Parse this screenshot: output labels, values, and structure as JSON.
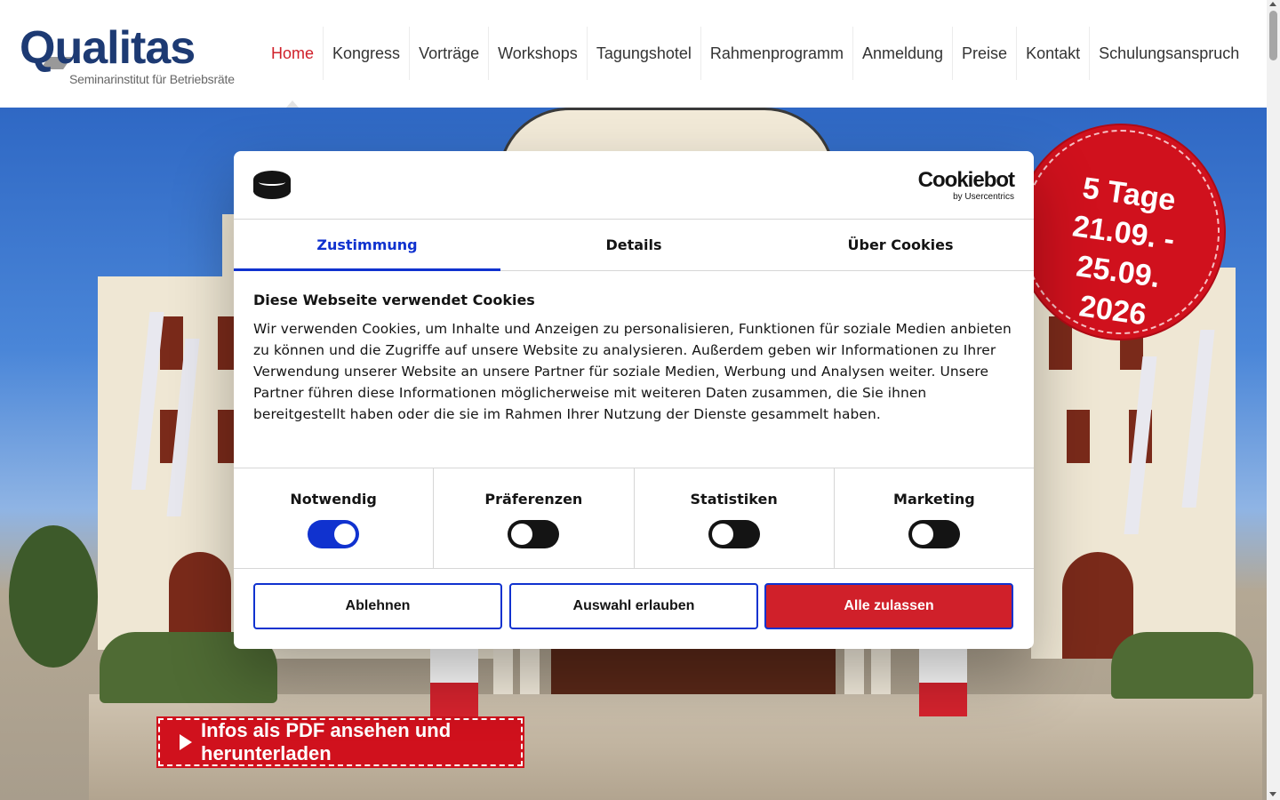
{
  "logo": {
    "brand": "Qualitas",
    "tagline": "Seminarinstitut für Betriebsräte"
  },
  "nav": {
    "items": [
      {
        "label": "Home",
        "active": true
      },
      {
        "label": "Kongress"
      },
      {
        "label": "Vorträge"
      },
      {
        "label": "Workshops"
      },
      {
        "label": "Tagungshotel"
      },
      {
        "label": "Rahmenprogramm"
      },
      {
        "label": "Anmeldung"
      },
      {
        "label": "Preise"
      },
      {
        "label": "Kontakt"
      },
      {
        "label": "Schulungsanspruch"
      }
    ]
  },
  "badge": {
    "line1": "5 Tage",
    "line2": "21.09. - 25.09.",
    "line3": "2026"
  },
  "pdf_button": {
    "label": "Infos als PDF ansehen und herunterladen"
  },
  "cookie_dialog": {
    "brand": "Cookiebot",
    "brand_sub": "by Usercentrics",
    "tabs": [
      {
        "label": "Zustimmung",
        "active": true
      },
      {
        "label": "Details"
      },
      {
        "label": "Über Cookies"
      }
    ],
    "title": "Diese Webseite verwendet Cookies",
    "text": "Wir verwenden Cookies, um Inhalte und Anzeigen zu personalisieren, Funktionen für soziale Medien anbieten zu können und die Zugriffe auf unsere Website zu analysieren. Außerdem geben wir Informationen zu Ihrer Verwendung unserer Website an unsere Partner für soziale Medien, Werbung und Analysen weiter. Unsere Partner führen diese Informationen möglicherweise mit weiteren Daten zusammen, die Sie ihnen bereitgestellt haben oder die sie im Rahmen Ihrer Nutzung der Dienste gesammelt haben.",
    "preferences": [
      {
        "label": "Notwendig",
        "checked": true
      },
      {
        "label": "Präferenzen",
        "checked": false
      },
      {
        "label": "Statistiken",
        "checked": false
      },
      {
        "label": "Marketing",
        "checked": false
      }
    ],
    "buttons": {
      "decline": "Ablehnen",
      "allow_selection": "Auswahl erlauben",
      "allow_all": "Alle zulassen"
    }
  },
  "colors": {
    "brand_blue": "#1d3a73",
    "accent_red": "#d0202a",
    "cookiebot_blue": "#1032cf"
  },
  "icons": {
    "cookiebot_logo": "cookiebot-logo-icon",
    "pdf_play": "play-icon"
  }
}
